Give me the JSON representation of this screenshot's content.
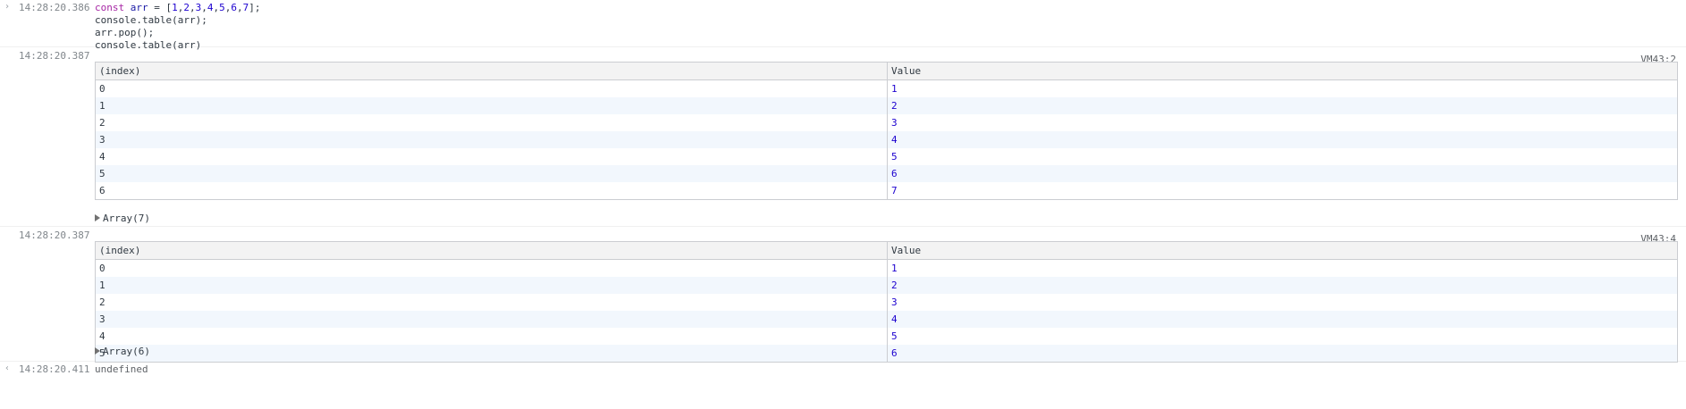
{
  "input_entry": {
    "timestamp": "14:28:20.386",
    "code_lines": [
      {
        "parts": [
          [
            "kw",
            "const "
          ],
          [
            "var",
            "arr"
          ],
          [
            "punct",
            " = ["
          ],
          [
            "num",
            "1"
          ],
          [
            "punct",
            ","
          ],
          [
            "num",
            "2"
          ],
          [
            "punct",
            ","
          ],
          [
            "num",
            "3"
          ],
          [
            "punct",
            ","
          ],
          [
            "num",
            "4"
          ],
          [
            "punct",
            ","
          ],
          [
            "num",
            "5"
          ],
          [
            "punct",
            ","
          ],
          [
            "num",
            "6"
          ],
          [
            "punct",
            ","
          ],
          [
            "num",
            "7"
          ],
          [
            "punct",
            "];"
          ]
        ]
      },
      {
        "text": "console.table(arr);"
      },
      {
        "text": "arr.pop();"
      },
      {
        "text": "console.table(arr)"
      }
    ]
  },
  "tables": [
    {
      "timestamp": "14:28:20.387",
      "source": "VM43:2",
      "headers": [
        "(index)",
        "Value"
      ],
      "rows": [
        [
          "0",
          "1"
        ],
        [
          "1",
          "2"
        ],
        [
          "2",
          "3"
        ],
        [
          "3",
          "4"
        ],
        [
          "4",
          "5"
        ],
        [
          "5",
          "6"
        ],
        [
          "6",
          "7"
        ]
      ],
      "expander": "Array(7)"
    },
    {
      "timestamp": "14:28:20.387",
      "source": "VM43:4",
      "headers": [
        "(index)",
        "Value"
      ],
      "rows": [
        [
          "0",
          "1"
        ],
        [
          "1",
          "2"
        ],
        [
          "2",
          "3"
        ],
        [
          "3",
          "4"
        ],
        [
          "4",
          "5"
        ],
        [
          "5",
          "6"
        ]
      ],
      "expander": "Array(6)"
    }
  ],
  "result_entry": {
    "timestamp": "14:28:20.411",
    "value": "undefined"
  },
  "icons": {
    "input_arrow": "chevron-right-icon",
    "result_arrow": "return-arrow-icon",
    "expand": "triangle-right-icon"
  }
}
